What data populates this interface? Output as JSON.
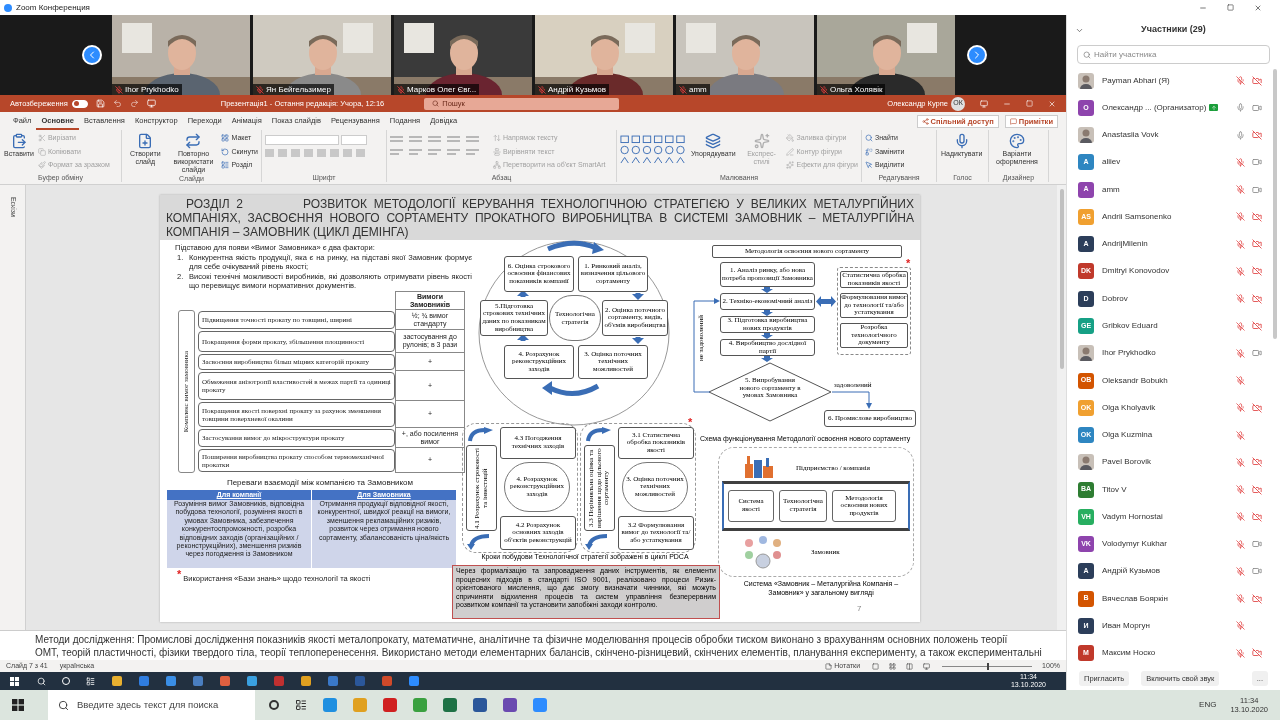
{
  "window": {
    "title": "Zoom Конференция"
  },
  "video_tiles": [
    {
      "name": "Ihor Prykhodko",
      "muted": true
    },
    {
      "name": "Ян Бейгельзимер",
      "muted": true
    },
    {
      "name": "Марков Олег Євг...",
      "muted": true
    },
    {
      "name": "Андрій Кузьмов",
      "muted": true
    },
    {
      "name": "amm",
      "muted": true
    },
    {
      "name": "Ольга Холявік",
      "muted": true
    }
  ],
  "powerpoint": {
    "title_bar": {
      "autosave": "Автозбереження",
      "autosave_on": false,
      "document": "Презентація1 - Остання редакція: Учора, 12:16",
      "search_placeholder": "Пошук",
      "user": "Олександр Курпе",
      "user_initials": "ОК"
    },
    "tabs": [
      {
        "label": "Файл",
        "selected": false
      },
      {
        "label": "Основне",
        "selected": true
      },
      {
        "label": "Вставлення",
        "selected": false
      },
      {
        "label": "Конструктор",
        "selected": false
      },
      {
        "label": "Переходи",
        "selected": false
      },
      {
        "label": "Анімація",
        "selected": false
      },
      {
        "label": "Показ слайдів",
        "selected": false
      },
      {
        "label": "Рецензування",
        "selected": false
      },
      {
        "label": "Подання",
        "selected": false
      },
      {
        "label": "Довідка",
        "selected": false
      }
    ],
    "share": "Спільний доступ",
    "comments": "Примітки",
    "ribbon_groups": [
      {
        "label": "Буфер обміну",
        "large": [
          {
            "label": "Вставити",
            "disabled": false
          }
        ],
        "small": [
          {
            "label": "Вирізати",
            "disabled": true
          },
          {
            "label": "Копіювати",
            "disabled": true
          },
          {
            "label": "Формат за зразком",
            "disabled": true
          }
        ]
      },
      {
        "label": "Слайди",
        "large": [
          {
            "label": "Створити слайд",
            "disabled": false
          },
          {
            "label": "Повторно використати слайди",
            "disabled": false
          }
        ],
        "small": [
          {
            "label": "Макет",
            "disabled": false
          },
          {
            "label": "Скинути",
            "disabled": false
          },
          {
            "label": "Розділ",
            "disabled": false
          }
        ]
      },
      {
        "label": "Шрифт"
      },
      {
        "label": "Абзац",
        "small": [
          {
            "label": "Напрямок тексту",
            "disabled": true
          },
          {
            "label": "Вирівняти текст",
            "disabled": true
          },
          {
            "label": "Перетворити на об'єкт SmartArt",
            "disabled": true
          }
        ]
      },
      {
        "label": "Малювання",
        "large": [
          {
            "label": "Упорядкувати",
            "disabled": false
          },
          {
            "label": "Експрес-стилі",
            "disabled": true
          }
        ],
        "small": [
          {
            "label": "Заливка фігури",
            "disabled": true
          },
          {
            "label": "Контур фігури",
            "disabled": true
          },
          {
            "label": "Ефекти для фігури",
            "disabled": true
          }
        ]
      },
      {
        "label": "Редагування",
        "small": [
          {
            "label": "Знайти",
            "disabled": false
          },
          {
            "label": "Замінити",
            "disabled": false
          },
          {
            "label": "Виділити",
            "disabled": false
          }
        ]
      },
      {
        "label": "Голос",
        "large": [
          {
            "label": "Надиктувати",
            "disabled": false
          }
        ]
      },
      {
        "label": "Дизайнер",
        "large": [
          {
            "label": "Варіанти оформлення",
            "disabled": false
          }
        ]
      }
    ],
    "thumbnails_label": "Ескізи",
    "slide": {
      "section": "РОЗДІЛ 2",
      "title": "РОЗВИТОК МЕТОДОЛОГІЇ КЕРУВАННЯ ТЕХНОЛОГІЧНОЮ СТРАТЕГІЄЮ У ВЕЛИКИХ МЕТАЛУРГІЙНИХ КОМПАНІЯХ, ЗАСВОЄННЯ НОВОГО СОРТАМЕНТУ ПРОКАТНОГО ВИРОБНИЦТВА В СИСТЕМІ ЗАМОВНИК – МЕТАЛУРГІЙНА КОМПАНІЯ – ЗАМОВНИК (ЦИКЛ ДЕМІНГА)",
      "intro": "Підставою для появи «Вимог Замовника» є два фактори:",
      "factors": [
        {
          "number": "1.",
          "text": "Конкурентна якість продукції, яка є на ринку, на підставі якої Замовник формує для себе очікуваний рівень якості;"
        },
        {
          "number": "2.",
          "text": "Високі технічні можливості виробників, які дозволяють отримувати рівень якості що перевищує вимоги нормативних документів."
        }
      ],
      "requirements": {
        "side_label": "Комплекс вимог замовника",
        "header": "Вимоги Замовників",
        "rows": [
          {
            "requirement": "Підвищення точності прокату по товщині, ширині",
            "customer": "½; ¾ вимог стандарту"
          },
          {
            "requirement": "Покращення форми прокату, збільшення площинності",
            "customer": "застосування до рулонів; в 3 рази"
          },
          {
            "requirement": "Засвоєння виробництва більш міцних категорій прокату",
            "customer": "+"
          },
          {
            "requirement": "Обмеження анізотропії властивостей в межах партії та одиниці прокату",
            "customer": "+"
          },
          {
            "requirement": "Покращення якості поверхні прокату за рахунок зменшення товщини поверхневої окалини",
            "customer": "+"
          },
          {
            "requirement": "Застосування вимог до мікроструктури прокату",
            "customer": "+, або посилення вимог"
          },
          {
            "requirement": "Поширення виробництва прокату способом термомеханічної прокатки",
            "customer": "+"
          }
        ]
      },
      "benefits": {
        "title": "Переваги взаємодії між компанією та Замовником",
        "columns": [
          {
            "header": "Для компанії",
            "text": "Розуміння вимог Замовників, відповідна побудова технології, розуміння якості в умовах Замовника, забезпечення конкурентоспроможності, розробка відповідних заходів (організаційних / реконструкційних), зменшення ризиків через погодження із Замовником"
          },
          {
            "header": "Для Замовника",
            "text": "Отримання продукції відповідної якості, конкурентної, швидкої реакції на вимоги, зменшення рекламаційних ризиків, розвиток через отримання нового сортаменту, збалансованість ціна/якість"
          }
        ]
      },
      "knowledge_note": {
        "mark": "*",
        "text": "Використання «Бази знань» щодо технології та якості"
      },
      "pdca": {
        "center": "Технологічна стратегія",
        "steps": [
          "6. Оцінка строкового освоєння фінансових показників компанії",
          "1. Ринковий аналіз, визначення цільового сортаменту",
          "5.Підготовка строкових технічних даних по показникам виробництва",
          "2. Оцінка поточного сортаменту, видів, об'ємів виробництва",
          "4. Розрахунок реконструкційних заходів",
          "3. Оцінка поточних технічних можливостей"
        ],
        "sub_cycles": [
          {
            "center": "4. Розрахунок реконструкційних заходів",
            "steps": [
              "4.1 Розрахунок строковості та інвестицій",
              "4.3 Погодження технічних заходів",
              "4.2 Розрахунок основних заходів об'єктів реконструкцій"
            ]
          },
          {
            "center": "3. Оцінка поточних технічних можливостей",
            "mark": "*",
            "steps": [
              "3.3 Порівняльна оцінка та вирішення щодо цільового сортаменту",
              "3.1 Статистична обробка показників якості",
              "3.2 Формулювання вимог до технології та/або устаткування"
            ]
          }
        ],
        "caption": "Кроки побудови Технологічної стратегії зображені в циклі PDCA"
      },
      "conclusion": "Через формалізацію та запровадження даних інструментів, як елементи процесних підходів в стандарті ISO 9001, реалізовано процеси Ризик-орієнтованого мислення, що дає змогу визначати чинники, які можуть спричиняти відхилення процесів та систем управління безперервним розвитком компанії та установити запобіжні заходи контролю.",
      "methodology": {
        "title": "Методологія освоєння нового сортаменту",
        "steps": [
          "1. Аналіз ринку, або нова потреба пропозиції Замовника",
          "2. Техніко-економічний аналіз",
          "3. Підготовка виробництва нових продуктів",
          "4. Виробництво дослідної партії"
        ],
        "test": "5. Випробування нового сортаменту в умовах Замовника",
        "rejected": "не задоволений",
        "accepted": "задоволений",
        "production": "6. Промислове виробництво",
        "mark": "*",
        "side_steps": [
          "Статистична обробка показників якості",
          "Формулювання вимог до технології та/або устаткування",
          "Розробка технологічного документу"
        ],
        "caption": "Схема функціонування Методології освоєння нового сортаменту"
      },
      "system": {
        "company": "Підприємство / компанія",
        "parts": [
          "Система якості",
          "Технологічна стратегія",
          "Методологія освоєння нових продуктів"
        ],
        "customer": "Замовник",
        "caption": "Система «Замовник – Металургійна Компанія – Замовник» у загальному вигляді"
      },
      "page": "7"
    },
    "notes_lines": [
      "Методи дослідження: Промислові дослідження показників якості металопрокату, математичне, аналітичне та фізичне моделювання процесів обробки тиском виконано з врахуванням основних положень теорії",
      "ОМТ, теорій пластичності, фізики твердого тіла, теорії теплоперенесення. Використано методи елементарних балансів, скінчено-різницевий, скінчених елементів, планування експерименту, а також експериментальні"
    ],
    "status": {
      "slide": "Слайд 7 з 41",
      "language": "українська",
      "notes": "Нотатки",
      "zoom_slider": {
        "level": 0.5
      },
      "zoom": "100%"
    }
  },
  "remote_taskbar": {
    "time": "11:34",
    "date": "13.10.2020"
  },
  "participants": {
    "title": "Участники (29)",
    "search_placeholder": "Найти участника",
    "items": [
      {
        "name": "Payman Abhari (Я)",
        "muted": true,
        "camera_on": false
      },
      {
        "name": "Олександр ... (Организатор)",
        "kind": "initials",
        "initials": "О",
        "color": "#8e44ad",
        "sharing": true,
        "muted": false,
        "camera_on": true
      },
      {
        "name": "Anastasiia Vovk",
        "muted": false,
        "camera_on": false
      },
      {
        "name": "aliiev",
        "kind": "initials",
        "initials": "A",
        "color": "#2e86c1",
        "muted": true,
        "camera_on": true
      },
      {
        "name": "amm",
        "kind": "initials",
        "initials": "A",
        "color": "#8e44ad",
        "muted": true,
        "camera_on": true
      },
      {
        "name": "Andrii Samsonenko",
        "kind": "initials",
        "initials": "AS",
        "color": "#f0a030",
        "muted": true,
        "camera_on": false
      },
      {
        "name": "AndrijMilenin",
        "kind": "initials",
        "initials": "A",
        "color": "#2c3e5a",
        "muted": true,
        "camera_on": false
      },
      {
        "name": "Dmitryi Konovodov",
        "kind": "initials",
        "initials": "DK",
        "color": "#c0392b",
        "muted": true,
        "camera_on": false
      },
      {
        "name": "Dobrov",
        "kind": "initials",
        "initials": "D",
        "color": "#2c3e5a",
        "muted": true,
        "camera_on": false
      },
      {
        "name": "Gribkov Eduard",
        "kind": "initials",
        "initials": "GE",
        "color": "#16a085",
        "muted": true,
        "camera_on": false
      },
      {
        "name": "Ihor Prykhodko",
        "muted": true,
        "camera_on": true
      },
      {
        "name": "Oleksandr Bobukh",
        "kind": "initials",
        "initials": "OB",
        "color": "#d35400",
        "muted": true
      },
      {
        "name": "Olga Kholyavik",
        "kind": "initials",
        "initials": "OK",
        "color": "#f0a030",
        "muted": true,
        "camera_on": false
      },
      {
        "name": "Olga Kuzmina",
        "kind": "initials",
        "initials": "OK",
        "color": "#2e86c1",
        "muted": true
      },
      {
        "name": "Pavel Borovik",
        "muted": true,
        "camera_on": false
      },
      {
        "name": "Titov V",
        "kind": "initials",
        "initials": "BA",
        "color": "#2e7d32",
        "muted": true,
        "camera_on": false
      },
      {
        "name": "Vadym Hornostai",
        "kind": "initials",
        "initials": "VH",
        "color": "#27ae60",
        "muted": true,
        "camera_on": false
      },
      {
        "name": "Volodymyr Kukhar",
        "kind": "initials",
        "initials": "VK",
        "color": "#8e44ad",
        "muted": true,
        "camera_on": true
      },
      {
        "name": "Андрій Кузьмов",
        "kind": "initials",
        "initials": "A",
        "color": "#2c3e5a",
        "muted": true,
        "camera_on": true
      },
      {
        "name": "Вячеслав Бояркін",
        "kind": "initials",
        "initials": "B",
        "color": "#d35400",
        "muted": true,
        "camera_on": false
      },
      {
        "name": "Иван Моргун",
        "kind": "initials",
        "initials": "И",
        "color": "#2c3e5a",
        "muted": true
      },
      {
        "name": "Максим Носко",
        "kind": "initials",
        "initials": "M",
        "color": "#c0392b",
        "muted": true,
        "camera_on": false
      }
    ],
    "buttons": [
      "Пригласить",
      "Включить свой звук",
      "..."
    ]
  },
  "taskbar": {
    "search_placeholder": "Введите здесь текст для поиска",
    "language": "ENG",
    "time": "11:34",
    "date": "13.10.2020"
  }
}
